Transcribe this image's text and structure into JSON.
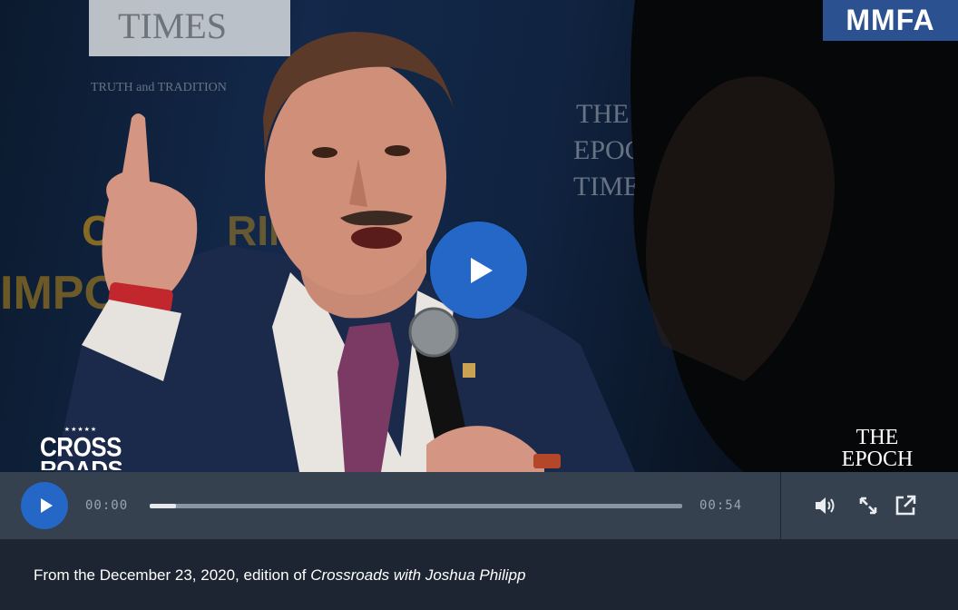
{
  "video": {
    "badge": "MMFA",
    "left_logo": {
      "stars": "★★★★★",
      "line1": "CROSS",
      "line2": "ROADS"
    },
    "right_logo": {
      "line1": "THE",
      "line2": "EPOCH"
    },
    "colors": {
      "accent": "#2467c7",
      "badge_bg": "#2b5190"
    }
  },
  "player": {
    "current_time": "00:00",
    "total_time": "00:54",
    "progress": 0.05
  },
  "caption": {
    "prefix": "From the December 23, 2020, edition of ",
    "show": "Crossroads with Joshua Philipp"
  }
}
